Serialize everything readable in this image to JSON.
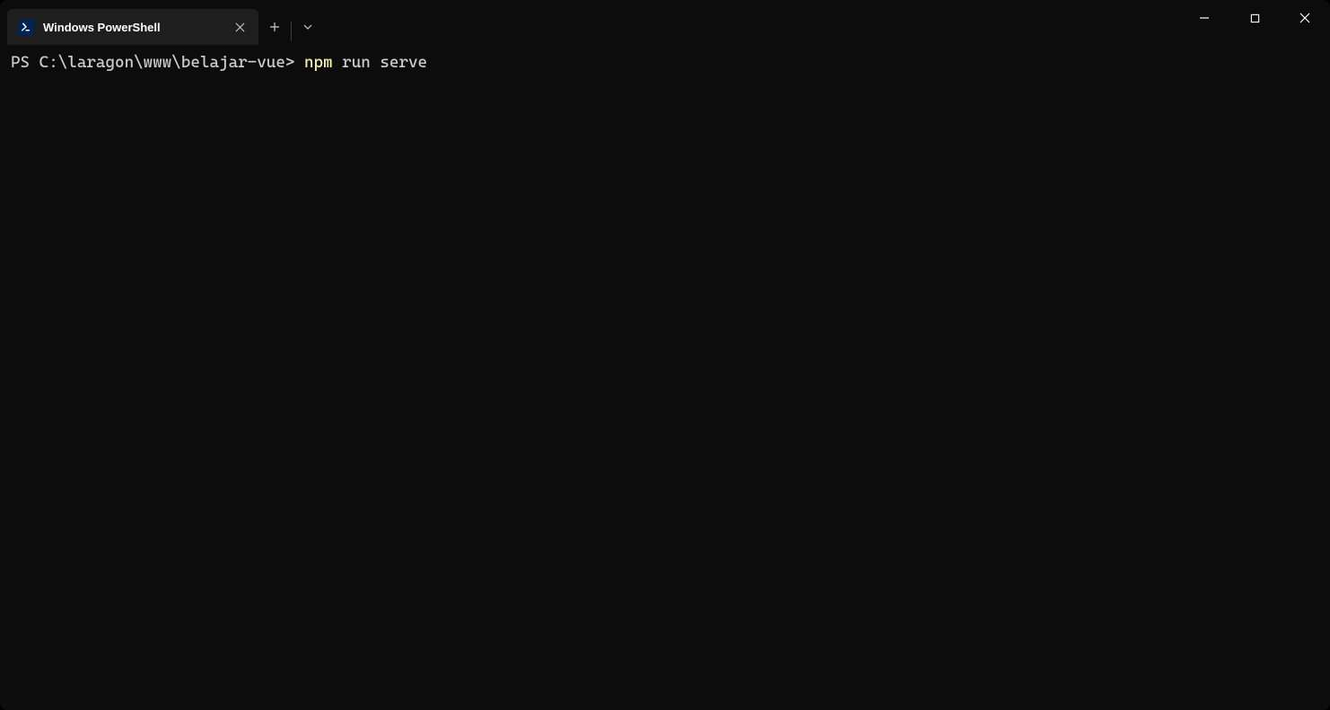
{
  "tab": {
    "title": "Windows PowerShell"
  },
  "terminal": {
    "prompt": "PS C:\\laragon\\www\\belajar-vue> ",
    "command_part1": "npm ",
    "command_part2": "run serve"
  }
}
